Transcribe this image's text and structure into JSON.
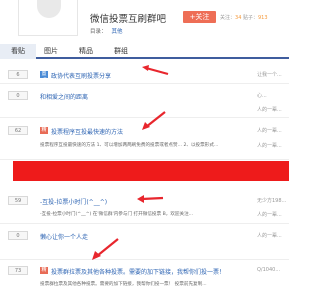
{
  "header": {
    "bar_name": "微信投票互刷群吧",
    "follow_label": "+关注",
    "stats_members_label": "关注：",
    "stats_members": "34",
    "stats_posts_label": "贴子：",
    "stats_posts": "913",
    "dir_label": "目录：",
    "dir_value": "其他"
  },
  "tabs": [
    {
      "label": "看贴",
      "active": true
    },
    {
      "label": "图片",
      "active": false
    },
    {
      "label": "精品",
      "active": false
    },
    {
      "label": "群组",
      "active": false
    }
  ],
  "threads": [
    {
      "replies": "6",
      "tag": "置顶",
      "tag_color": "blue",
      "title": "政协代表互刷投票分享",
      "author": "让我一个..."
    },
    {
      "replies": "0",
      "tag": "",
      "title": "和相爱之间的距离",
      "author": "心..."
    },
    {
      "replies": "",
      "tag": "",
      "title": "",
      "author": "人的一辈..."
    },
    {
      "replies": "62",
      "tag": "精",
      "tag_color": "red",
      "title": "投票程序互投最快速的方法",
      "author": "人的一辈...",
      "abstract": "投票程序互投最快速的方法 1、可以增加两两刷免费的投票或者点赞... 2、以投票形式..."
    },
    {
      "replies": "",
      "tag": "",
      "title": "",
      "author": "人的一辈..."
    },
    {
      "replies": "59",
      "tag": "",
      "title": "-互投-拉票小时门(^__^)",
      "author": "无少方198...",
      "abstract": "-互投-拉票小时门(^__^) 在'微信群'内参与门 打开微信投票 B，欢迎关注..."
    },
    {
      "replies": "",
      "tag": "",
      "title": "",
      "author": "人的一辈..."
    },
    {
      "replies": "0",
      "tag": "",
      "title": "懒心让你一个人走",
      "author": "人的一辈..."
    },
    {
      "replies": "73",
      "tag": "精",
      "tag_color": "red",
      "title": "投票群拉票及其他各种投票。需要的加下链接，我帮你们投一票！",
      "author": "Q/1040...",
      "abstract": "投票群拉票及其他各种投票。需要的加下链接，我帮你们投一票！ 投票前先复制..."
    }
  ]
}
